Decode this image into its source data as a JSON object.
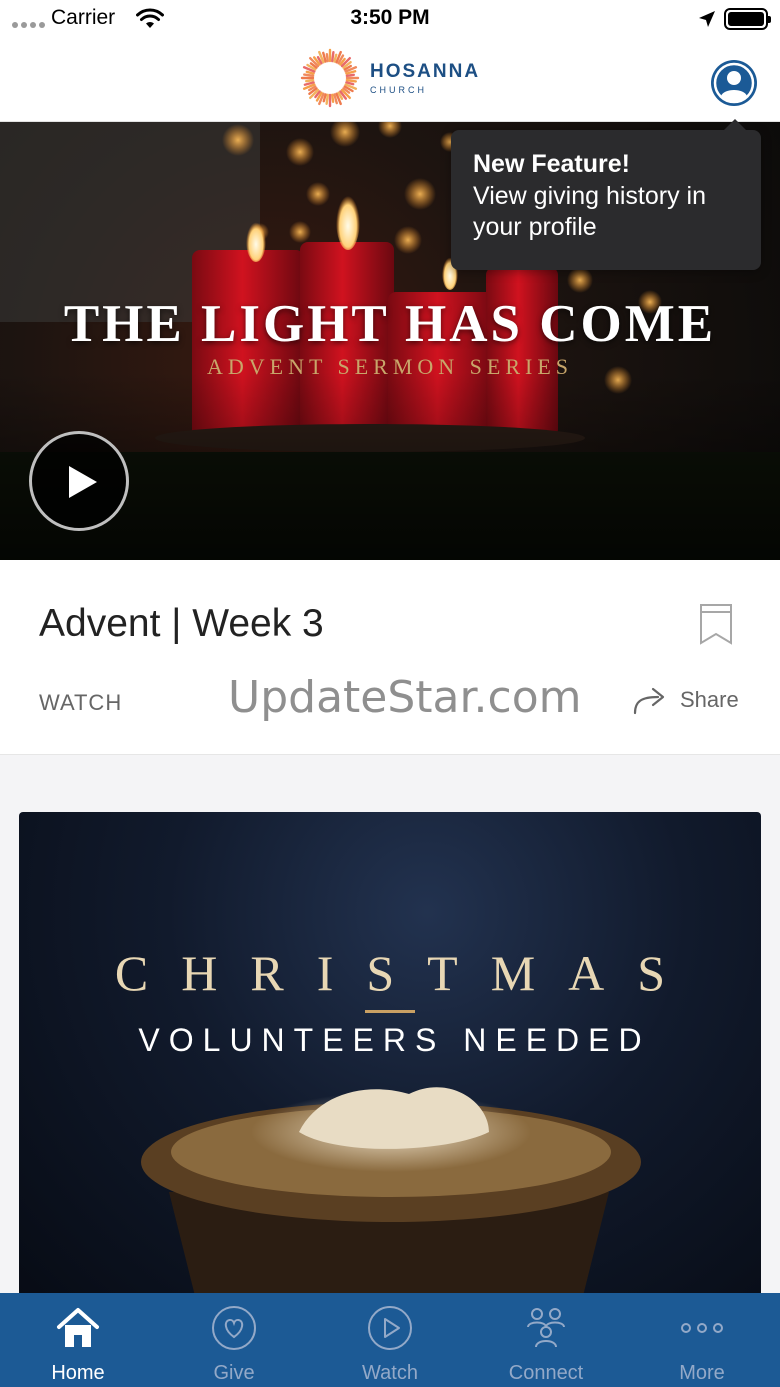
{
  "status_bar": {
    "carrier": "Carrier",
    "time": "3:50 PM"
  },
  "header": {
    "logo_name": "HOSANNA",
    "logo_sub": "CHURCH"
  },
  "tooltip": {
    "title": "New Feature!",
    "body": "View giving history in your profile"
  },
  "hero": {
    "title": "THE LIGHT HAS COME",
    "subtitle": "ADVENT SERMON SERIES"
  },
  "sermon": {
    "title": "Advent | Week 3",
    "watch_label": "WATCH",
    "share_label": "Share"
  },
  "watermark": "UpdateStar.com",
  "promo": {
    "title": "CHRISTMAS",
    "subtitle": "VOLUNTEERS NEEDED"
  },
  "tabs": [
    {
      "label": "Home",
      "icon": "home-icon",
      "active": true
    },
    {
      "label": "Give",
      "icon": "heart-icon",
      "active": false
    },
    {
      "label": "Watch",
      "icon": "play-circle-icon",
      "active": false
    },
    {
      "label": "Connect",
      "icon": "people-icon",
      "active": false
    },
    {
      "label": "More",
      "icon": "more-dots-icon",
      "active": false
    }
  ],
  "colors": {
    "brand_blue": "#1c5a95",
    "tab_inactive": "#93a9c8",
    "tooltip_bg": "#2b2b2d",
    "gold": "#c8a66a"
  }
}
